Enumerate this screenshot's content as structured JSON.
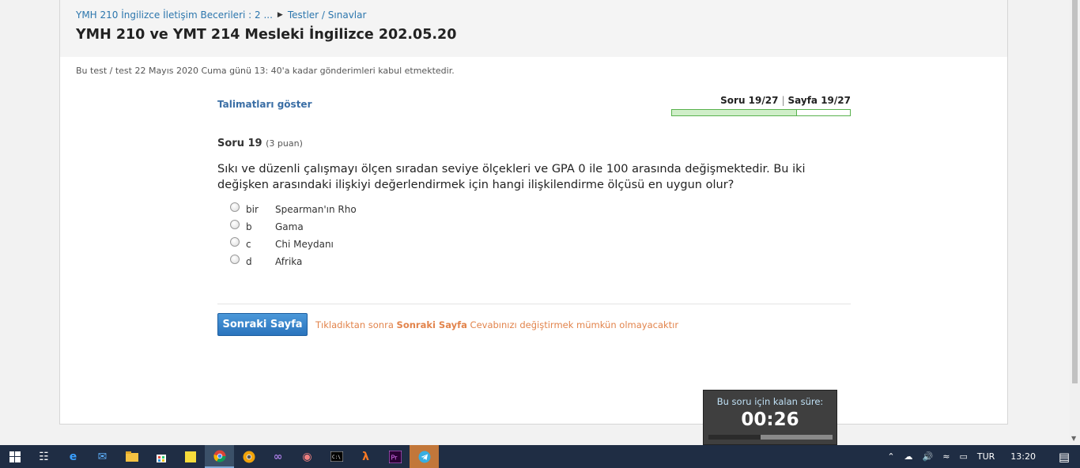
{
  "breadcrumb": {
    "course": "YMH 210 İngilizce İletişim Becerileri : 2 ...",
    "section": "Testler / Sınavlar"
  },
  "page_title": "YMH 210 ve YMT 214 Mesleki İngilizce 202.05.20",
  "notice": "Bu test / test 22 Mayıs 2020 Cuma günü 13: 40'a kadar gönderimleri kabul etmektedir.",
  "quiz": {
    "instructions_link": "Talimatları göster",
    "progress_question": "Soru 19/27",
    "progress_page": "Sayfa 19/27",
    "progress_fraction": 0.7037,
    "question_label": "Soru 19",
    "question_points": "(3 puan)",
    "question_text": "Sıkı ve düzenli çalışmayı ölçen sıradan seviye ölçekleri ve GPA 0 ile 100 arasında değişmektedir. Bu iki değişken arasındaki ilişkiyi değerlendirmek için hangi ilişkilendirme ölçüsü en uygun olur?",
    "options": [
      {
        "key": "bir",
        "text": "Spearman'ın Rho"
      },
      {
        "key": "b",
        "text": "Gama"
      },
      {
        "key": "c",
        "text": "Chi Meydanı"
      },
      {
        "key": "d",
        "text": "Afrika"
      }
    ],
    "next_button": "Sonraki Sayfa",
    "next_note_prefix": "Tıkladıktan sonra",
    "next_note_bold": "Sonraki Sayfa",
    "next_note_suffix": "Cevabınızı değiştirmek mümkün olmayacaktır"
  },
  "timer": {
    "label": "Bu soru için kalan süre:",
    "value": "00:26",
    "remaining_fraction": 0.42
  },
  "taskbar": {
    "language": "TUR",
    "clock": "13:20",
    "icons": [
      "windows-start-icon",
      "task-view-icon",
      "edge-icon",
      "mail-icon",
      "file-explorer-icon",
      "store-icon",
      "sticky-notes-icon",
      "chrome-icon",
      "chrome-canary-icon",
      "visual-studio-icon",
      "paint-icon",
      "terminal-icon",
      "xampp-icon",
      "premiere-icon",
      "telegram-icon"
    ]
  },
  "colors": {
    "link": "#2c76ad",
    "accent_orange": "#e2844c",
    "button_blue": "#2a74bd",
    "progress_green": "#59b24e",
    "taskbar": "#1f2d44"
  }
}
